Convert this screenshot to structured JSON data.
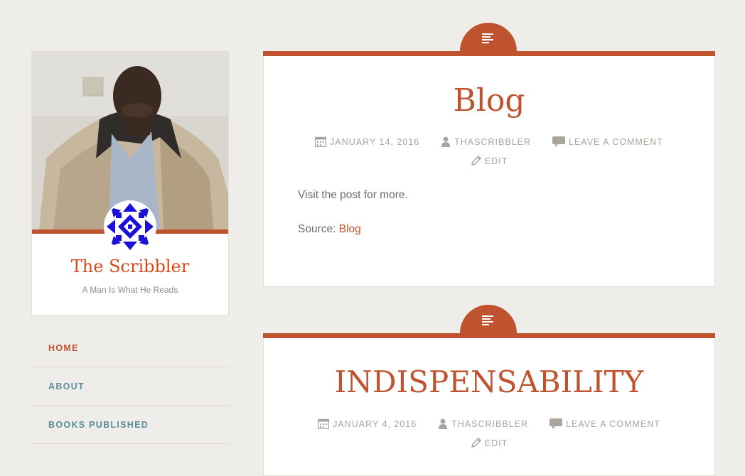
{
  "site": {
    "title": "The Scribbler",
    "tagline": "A Man Is What He Reads"
  },
  "nav": {
    "items": [
      {
        "label": "HOME",
        "active": true
      },
      {
        "label": "ABOUT",
        "active": false
      },
      {
        "label": "BOOKS PUBLISHED",
        "active": false
      }
    ]
  },
  "posts": [
    {
      "title": "Blog",
      "date": "JANUARY 14, 2016",
      "author": "THASCRIBBLER",
      "comment_link": "LEAVE A COMMENT",
      "edit_link": "EDIT",
      "body": "Visit the post for more.",
      "source_label": "Source: ",
      "source_link": "Blog",
      "format_icon": "aside-format-icon"
    },
    {
      "title": "INDISPENSABILITY",
      "date": "JANUARY 4, 2016",
      "author": "THASCRIBBLER",
      "comment_link": "LEAVE A COMMENT",
      "edit_link": "EDIT",
      "format_icon": "aside-format-icon"
    }
  ],
  "colors": {
    "accent": "#c0532f",
    "site_title": "#d84a1b",
    "nav_link": "#5a8d9a",
    "meta": "#a9a49c",
    "background": "#efedea"
  }
}
